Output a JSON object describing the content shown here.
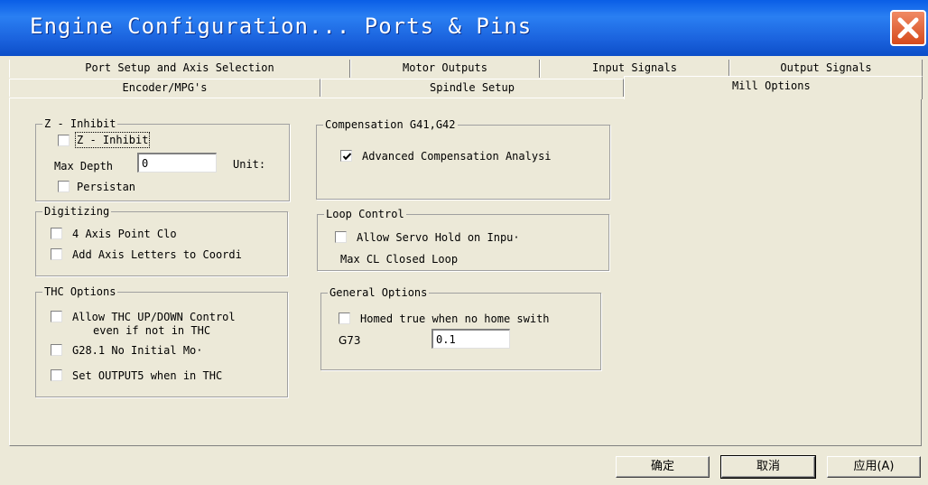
{
  "window": {
    "title": "Engine Configuration... Ports & Pins"
  },
  "tabs": {
    "row1": [
      "Port Setup and Axis Selection",
      "Motor Outputs",
      "Input Signals",
      "Output Signals"
    ],
    "row2": [
      "Encoder/MPG's",
      "Spindle Setup",
      "Mill Options"
    ],
    "active": "Mill Options"
  },
  "z_inhibit": {
    "legend": "Z - Inhibit",
    "checkbox_label": "Z - Inhibit",
    "checked": false,
    "max_depth_label": "Max Depth",
    "max_depth_value": "0",
    "units_label": "Unit:",
    "persistent_label": "Persistan",
    "persistent_checked": false
  },
  "digitizing": {
    "legend": "Digitizing",
    "point_cloud_label": "4 Axis Point Clo",
    "axis_letters_label": "Add Axis Letters to Coordi"
  },
  "thc": {
    "legend": "THC Options",
    "allow_updown_line1": "Allow THC UP/DOWN Control",
    "allow_updown_line2": "even if not in THC",
    "g28_label": "G28.1 No Initial Mo·",
    "output5_label": "Set OUTPUT5 when in THC"
  },
  "compensation": {
    "legend": "Compensation G41,G42",
    "advanced_label": "Advanced Compensation Analysi",
    "advanced_checked": true
  },
  "loop_control": {
    "legend": "Loop Control",
    "servo_hold_label": "Allow Servo Hold on Inpu·",
    "max_cl_label": "Max CL Closed Loop"
  },
  "general": {
    "legend": "General Options",
    "homed_label": "Homed true when no home swith",
    "g73_label": "G73",
    "g73_value": "0.1"
  },
  "buttons": {
    "ok": "确定",
    "cancel": "取消",
    "apply": "应用(A)"
  }
}
